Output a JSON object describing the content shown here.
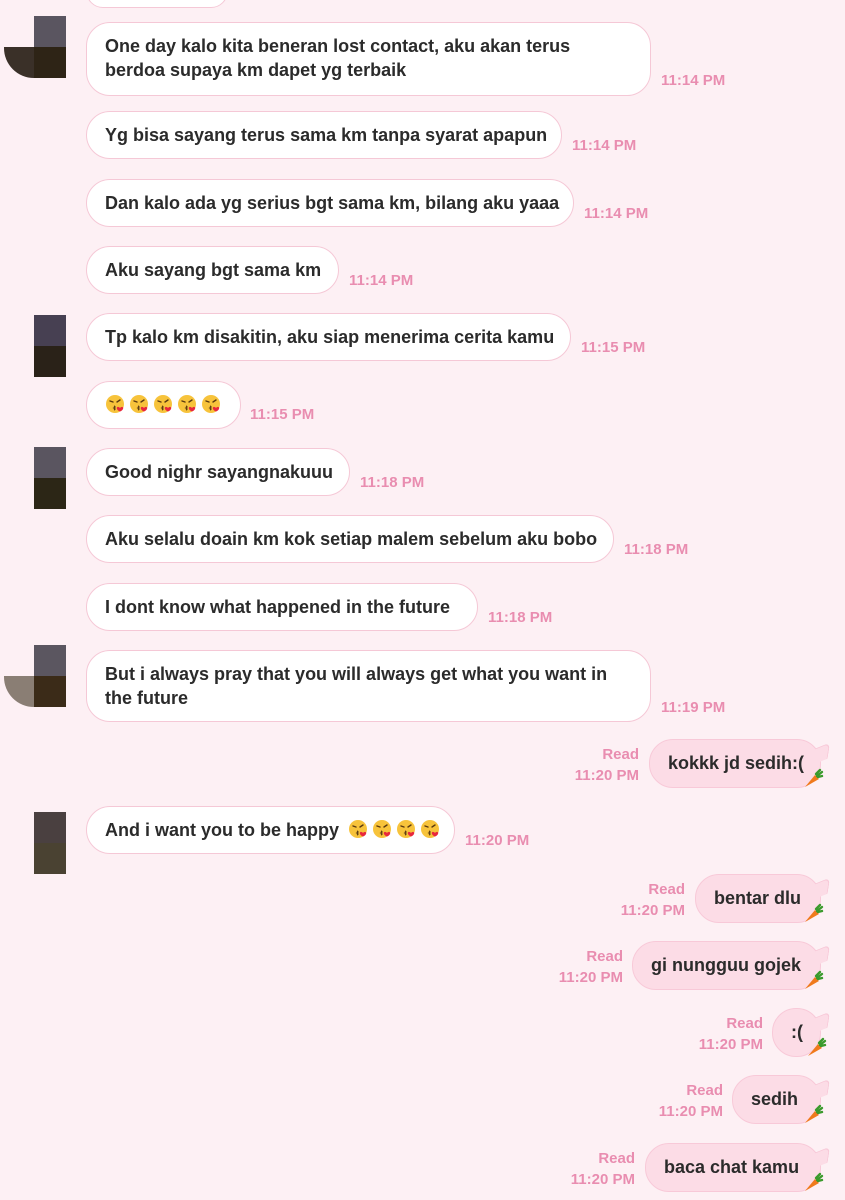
{
  "colors": {
    "background": "#fdf0f4",
    "received_bubble": "#ffffff",
    "sent_bubble": "#fcdce6",
    "timestamp": "#e98db0",
    "text": "#2b2b2b"
  },
  "messages": [
    {
      "dir": "in",
      "text": "One day kalo kita beneran lost contact, aku akan terus berdoa supaya km dapet yg terbaik",
      "time": "11:14 PM"
    },
    {
      "dir": "in",
      "text": "Yg bisa sayang terus sama km tanpa syarat apapun",
      "time": "11:14 PM"
    },
    {
      "dir": "in",
      "text": "Dan kalo ada yg serius bgt sama km, bilang aku yaaa",
      "time": "11:14 PM"
    },
    {
      "dir": "in",
      "text": "Aku sayang bgt sama km",
      "time": "11:14 PM"
    },
    {
      "dir": "in",
      "text": "Tp kalo km disakitin, aku siap menerima cerita kamu",
      "time": "11:15 PM"
    },
    {
      "dir": "in",
      "text": "",
      "emoji_count": 5,
      "emoji": "kissing-face-heart",
      "time": "11:15 PM"
    },
    {
      "dir": "in",
      "text": "Good nighr sayangnakuuu",
      "time": "11:18 PM"
    },
    {
      "dir": "in",
      "text": "Aku selalu doain km kok setiap malem sebelum aku bobo",
      "time": "11:18 PM"
    },
    {
      "dir": "in",
      "text": "I dont know what happened in the future",
      "time": "11:18 PM"
    },
    {
      "dir": "in",
      "text": "But i always pray that you will always get what you want in the future",
      "time": "11:19 PM"
    },
    {
      "dir": "out",
      "text": "kokkk jd sedih:(",
      "read": "Read",
      "time": "11:20 PM"
    },
    {
      "dir": "in",
      "text": "And i want you to be happy",
      "emoji_count": 4,
      "emoji": "kissing-face-heart",
      "time": "11:20 PM"
    },
    {
      "dir": "out",
      "text": "bentar dlu",
      "read": "Read",
      "time": "11:20 PM"
    },
    {
      "dir": "out",
      "text": "gi nungguu gojek",
      "read": "Read",
      "time": "11:20 PM"
    },
    {
      "dir": "out",
      "text": ":(",
      "read": "Read",
      "time": "11:20 PM"
    },
    {
      "dir": "out",
      "text": "sedih",
      "read": "Read",
      "time": "11:20 PM"
    },
    {
      "dir": "out",
      "text": "baca chat kamu",
      "read": "Read",
      "time": "11:20 PM"
    }
  ]
}
